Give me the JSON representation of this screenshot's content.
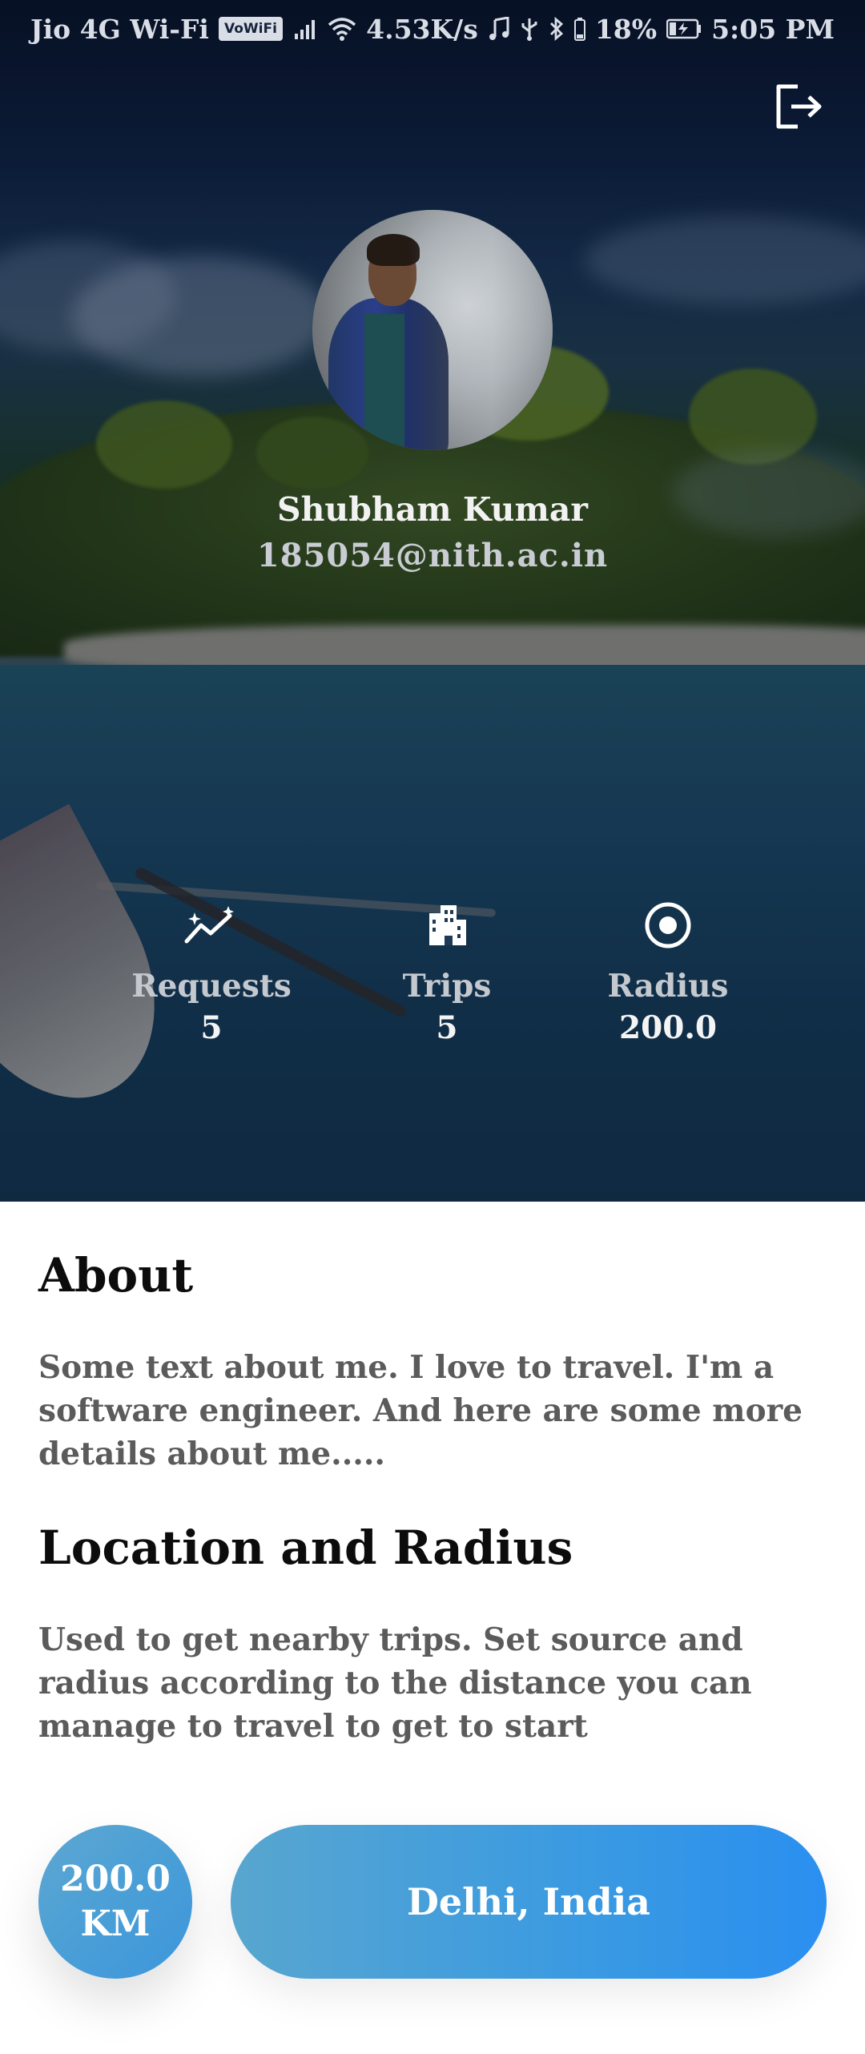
{
  "status_bar": {
    "carrier": "Jio 4G Wi-Fi",
    "volte_badge": "VoWiFi",
    "net_speed": "4.53K/s",
    "battery_percent": "18%",
    "time": "5:05 PM"
  },
  "profile": {
    "name": "Shubham Kumar",
    "email": "185054@nith.ac.in"
  },
  "stats": {
    "requests": {
      "label": "Requests",
      "value": "5",
      "icon": "sparkle-chart-icon"
    },
    "trips": {
      "label": "Trips",
      "value": "5",
      "icon": "buildings-icon"
    },
    "radius": {
      "label": "Radius",
      "value": "200.0",
      "icon": "target-icon"
    }
  },
  "about": {
    "title": "About",
    "body": "Some text about me. I love to travel. I'm a software engineer. And here are some more details about me....."
  },
  "location": {
    "title": "Location and Radius",
    "body": "Used to get nearby trips. Set source and radius according to the distance you can manage to travel to get to start",
    "radius_value": "200.0",
    "radius_unit": "KM",
    "place": "Delhi, India"
  },
  "colors": {
    "accent_blue": "#3c9be0",
    "badge_blue": "#4a9fd6",
    "title_text": "#0c0c0c",
    "body_text": "#5b5b5b"
  }
}
